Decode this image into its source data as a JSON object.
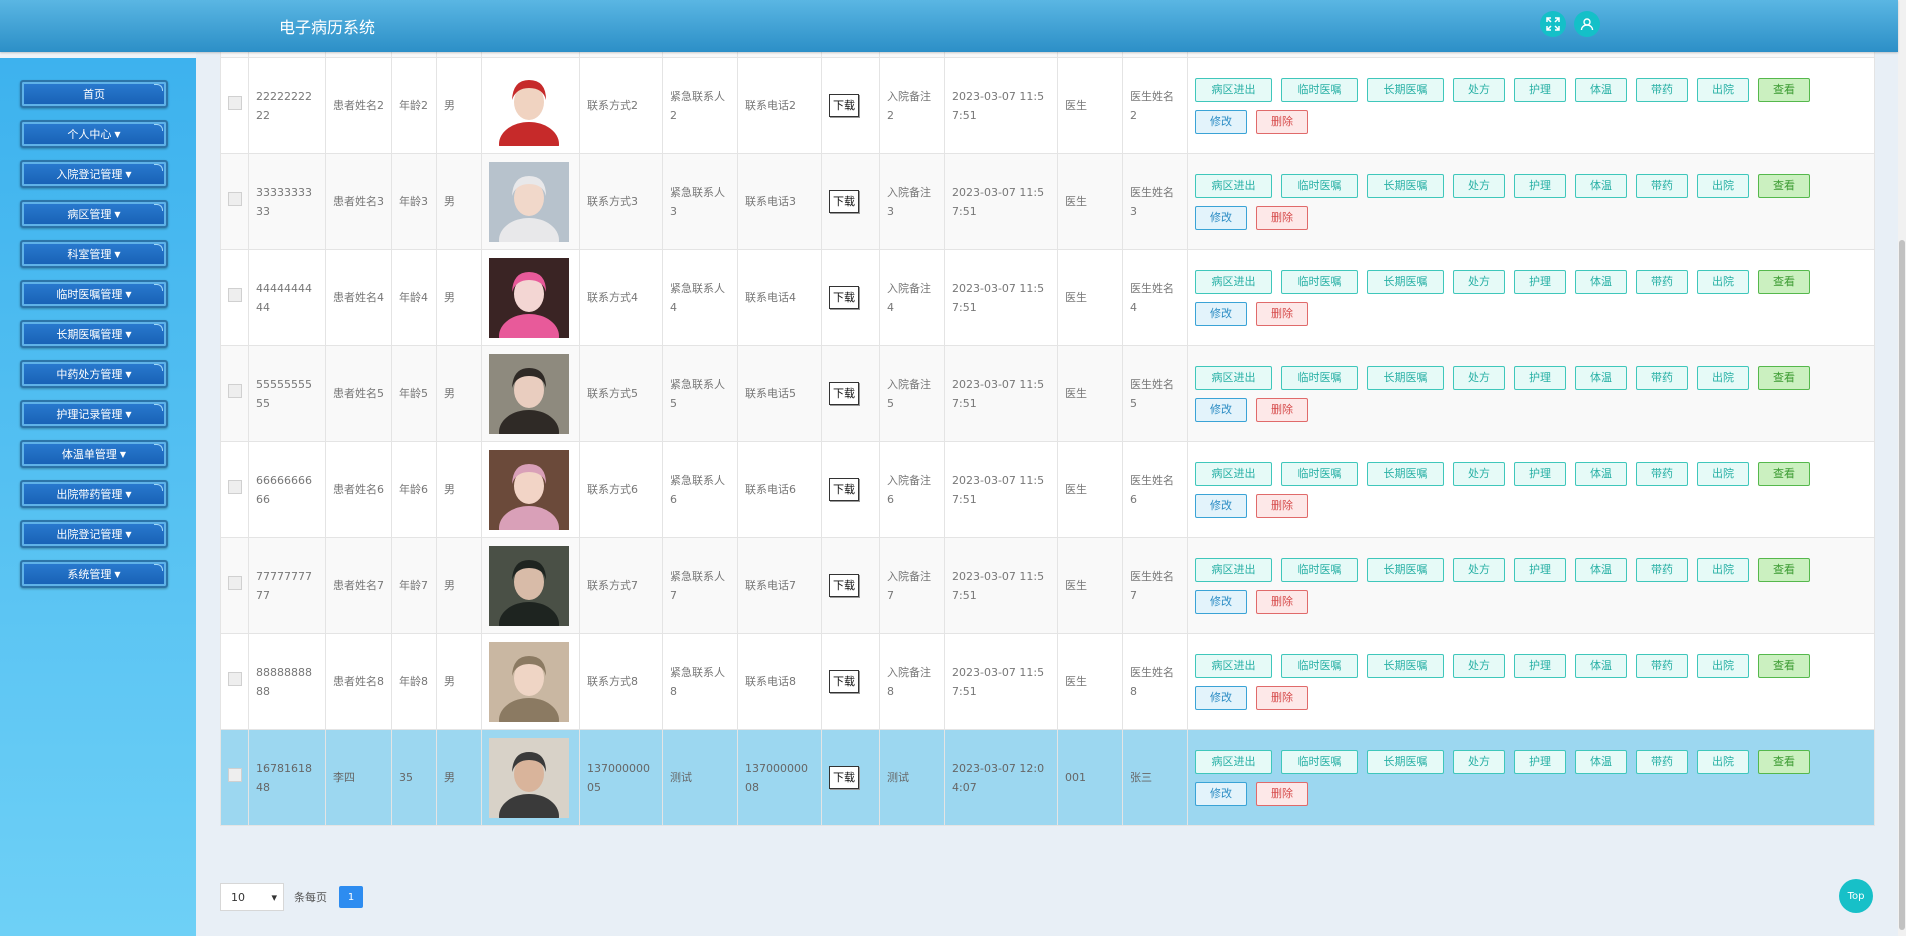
{
  "app": {
    "title": "电子病历系统"
  },
  "header": {
    "icons": [
      "fullscreen-icon",
      "user-icon"
    ]
  },
  "sidebar": {
    "items": [
      {
        "label": "首页",
        "dropdown": false
      },
      {
        "label": "个人中心",
        "dropdown": true
      },
      {
        "label": "入院登记管理",
        "dropdown": true
      },
      {
        "label": "病区管理",
        "dropdown": true
      },
      {
        "label": "科室管理",
        "dropdown": true
      },
      {
        "label": "临时医嘱管理",
        "dropdown": true
      },
      {
        "label": "长期医嘱管理",
        "dropdown": true
      },
      {
        "label": "中药处方管理",
        "dropdown": true
      },
      {
        "label": "护理记录管理",
        "dropdown": true
      },
      {
        "label": "体温单管理",
        "dropdown": true
      },
      {
        "label": "出院带药管理",
        "dropdown": true
      },
      {
        "label": "出院登记管理",
        "dropdown": true
      },
      {
        "label": "系统管理",
        "dropdown": true
      }
    ]
  },
  "table": {
    "download_label": "下载",
    "actions": [
      "病区进出",
      "临时医嘱",
      "长期医嘱",
      "处方",
      "护理",
      "体温",
      "带药",
      "出院",
      "查看",
      "修改",
      "删除"
    ],
    "rows": [
      {
        "id": "",
        "name": "",
        "age": "",
        "sex": "",
        "contact": "",
        "emer_name": "",
        "emer_phone": "",
        "note": "",
        "time": "",
        "doctor": "",
        "doc_name": "",
        "partial": true
      },
      {
        "id": "2222222222",
        "name": "患者姓名2",
        "age": "年龄2",
        "sex": "男",
        "contact": "联系方式2",
        "emer_name": "紧急联系人2",
        "emer_phone": "联系电话2",
        "note": "入院备注2",
        "time": "2023-03-07 11:57:51",
        "doctor": "医生",
        "doc_name": "医生姓名2"
      },
      {
        "id": "3333333333",
        "name": "患者姓名3",
        "age": "年龄3",
        "sex": "男",
        "contact": "联系方式3",
        "emer_name": "紧急联系人3",
        "emer_phone": "联系电话3",
        "note": "入院备注3",
        "time": "2023-03-07 11:57:51",
        "doctor": "医生",
        "doc_name": "医生姓名3"
      },
      {
        "id": "4444444444",
        "name": "患者姓名4",
        "age": "年龄4",
        "sex": "男",
        "contact": "联系方式4",
        "emer_name": "紧急联系人4",
        "emer_phone": "联系电话4",
        "note": "入院备注4",
        "time": "2023-03-07 11:57:51",
        "doctor": "医生",
        "doc_name": "医生姓名4"
      },
      {
        "id": "5555555555",
        "name": "患者姓名5",
        "age": "年龄5",
        "sex": "男",
        "contact": "联系方式5",
        "emer_name": "紧急联系人5",
        "emer_phone": "联系电话5",
        "note": "入院备注5",
        "time": "2023-03-07 11:57:51",
        "doctor": "医生",
        "doc_name": "医生姓名5"
      },
      {
        "id": "6666666666",
        "name": "患者姓名6",
        "age": "年龄6",
        "sex": "男",
        "contact": "联系方式6",
        "emer_name": "紧急联系人6",
        "emer_phone": "联系电话6",
        "note": "入院备注6",
        "time": "2023-03-07 11:57:51",
        "doctor": "医生",
        "doc_name": "医生姓名6"
      },
      {
        "id": "7777777777",
        "name": "患者姓名7",
        "age": "年龄7",
        "sex": "男",
        "contact": "联系方式7",
        "emer_name": "紧急联系人7",
        "emer_phone": "联系电话7",
        "note": "入院备注7",
        "time": "2023-03-07 11:57:51",
        "doctor": "医生",
        "doc_name": "医生姓名7"
      },
      {
        "id": "8888888888",
        "name": "患者姓名8",
        "age": "年龄8",
        "sex": "男",
        "contact": "联系方式8",
        "emer_name": "紧急联系人8",
        "emer_phone": "联系电话8",
        "note": "入院备注8",
        "time": "2023-03-07 11:57:51",
        "doctor": "医生",
        "doc_name": "医生姓名8"
      },
      {
        "id": "1678161848",
        "name": "李四",
        "age": "35",
        "sex": "男",
        "contact": "13700000005",
        "emer_name": "测试",
        "emer_phone": "13700000008",
        "note": "测试",
        "time": "2023-03-07 12:04:07",
        "doctor": "001",
        "doc_name": "张三",
        "selected": true
      }
    ]
  },
  "pagination": {
    "page_size": "10",
    "per_page_label": "条每页",
    "current_page": "1"
  },
  "back_to_top": {
    "label": "Top"
  },
  "colors": {
    "header": "#2c8fc7",
    "sidebar": "#3db2ee",
    "accent": "#17c0c8",
    "selected_row": "#9cd7f0"
  }
}
